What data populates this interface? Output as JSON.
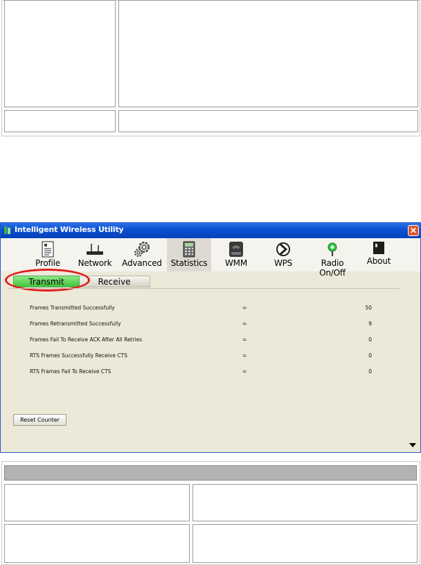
{
  "window": {
    "title": "Intelligent Wireless Utility",
    "close_glyph": "✕"
  },
  "toolbar": {
    "items": [
      {
        "label": "Profile",
        "icon": "profile-icon"
      },
      {
        "label": "Network",
        "icon": "network-icon"
      },
      {
        "label": "Advanced",
        "icon": "gears-icon"
      },
      {
        "label": "Statistics",
        "icon": "statistics-icon",
        "active": true
      },
      {
        "label": "WMM",
        "icon": "qos-icon"
      },
      {
        "label": "WPS",
        "icon": "wps-icon"
      },
      {
        "label": "Radio On/Off",
        "icon": "radio-icon"
      },
      {
        "label": "About",
        "icon": "about-icon"
      }
    ]
  },
  "tabs": {
    "transmit": "Transmit",
    "receive": "Receive"
  },
  "statistics": [
    {
      "label": "Frames Transmitted Successfully",
      "eq": "=",
      "value": "50"
    },
    {
      "label": "Frames Retransmitted Successfully",
      "eq": "=",
      "value": "9"
    },
    {
      "label": "Frames Fail To Receive ACK After All Retries",
      "eq": "=",
      "value": "0"
    },
    {
      "label": "RTS Frames Successfully Receive CTS",
      "eq": "=",
      "value": "0"
    },
    {
      "label": "RTS Frames Fail To Receive CTS",
      "eq": "=",
      "value": "0"
    }
  ],
  "reset_button": "Reset Counter",
  "colors": {
    "titlebar": "#0a4fd0",
    "transmit_tab": "#3fc33c",
    "highlight": "#e21b1b"
  }
}
